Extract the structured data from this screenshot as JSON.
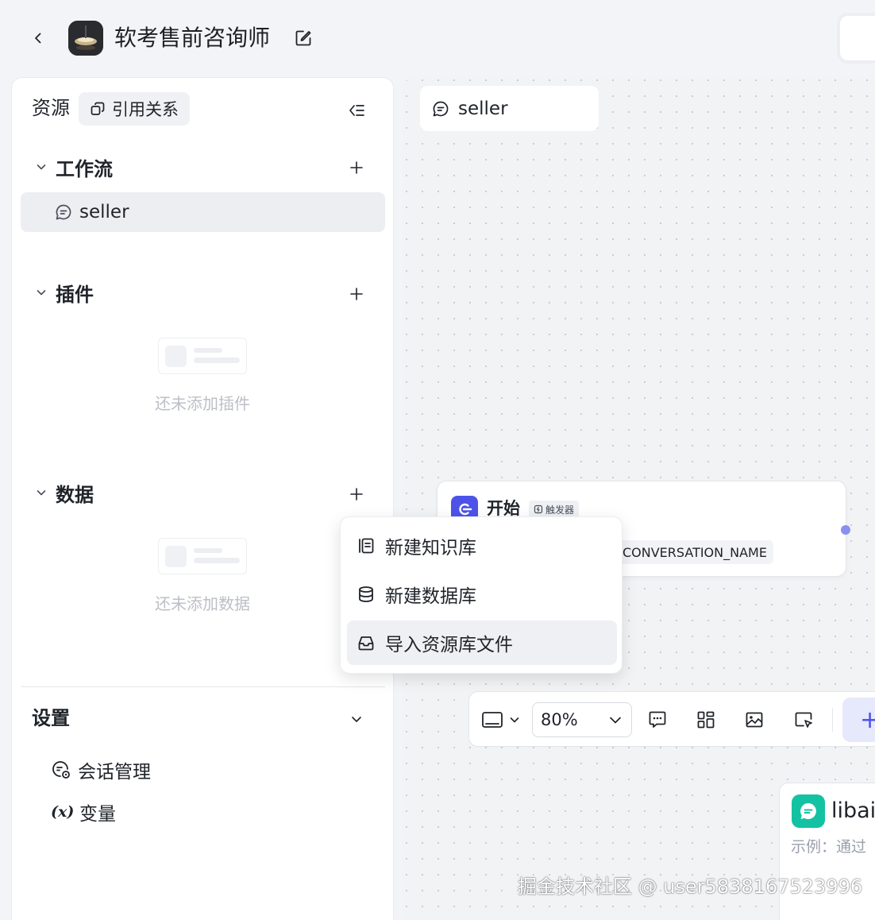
{
  "header": {
    "app_title": "软考售前咨询师"
  },
  "resources": {
    "title": "资源",
    "ref_button": "引用关系",
    "sections": {
      "workflow": {
        "title": "工作流",
        "items": [
          {
            "label": "seller"
          }
        ]
      },
      "plugins": {
        "title": "插件",
        "empty_text": "还未添加插件"
      },
      "data": {
        "title": "数据",
        "empty_text": "还未添加数据"
      }
    }
  },
  "settings": {
    "title": "设置",
    "items": [
      {
        "label": "会话管理",
        "icon": "conversation-settings-icon"
      },
      {
        "label": "变量",
        "icon": "variable-icon",
        "prefix": "(x)"
      }
    ]
  },
  "canvas": {
    "tab_label": "seller",
    "start_node": {
      "title": "开始",
      "badge": "触发器",
      "variable": "CONVERSATION_NAME"
    },
    "libai_node": {
      "title": "libai",
      "desc": "示例：通过"
    },
    "toolbar": {
      "zoom": "80%",
      "add_label": "+"
    }
  },
  "data_menu": {
    "items": [
      {
        "label": "新建知识库",
        "icon": "knowledge-base-icon"
      },
      {
        "label": "新建数据库",
        "icon": "database-icon"
      },
      {
        "label": "导入资源库文件",
        "icon": "import-inbox-icon",
        "active": true
      }
    ]
  },
  "watermark": "掘金技术社区 @ user5838167523996",
  "colors": {
    "accent": "#4d53e8",
    "libai_icon": "#13c2a3",
    "selected_bg": "#edeef2"
  }
}
